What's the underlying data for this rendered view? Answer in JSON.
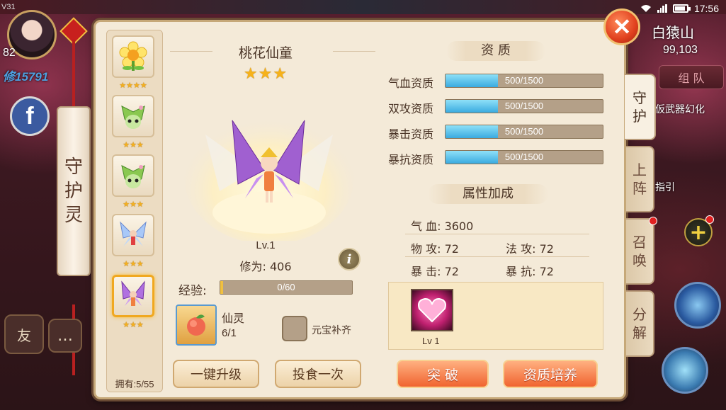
{
  "status_bar": {
    "time": "17:56"
  },
  "hud": {
    "version": "V31",
    "level": "82",
    "power": "修15791",
    "side_scroll_title": [
      "守",
      "护",
      "灵"
    ],
    "friend_label": "友",
    "map_name": "白猿山",
    "map_coord": "99,103",
    "team_label": "组 队",
    "quest_1": "仮武器幻化",
    "quest_2": "指引"
  },
  "pet_list": {
    "pets": [
      {
        "name": "sunflower-pet",
        "stars": "★★★★"
      },
      {
        "name": "leaf-pet-1",
        "stars": "★★★"
      },
      {
        "name": "leaf-pet-2",
        "stars": "★★★"
      },
      {
        "name": "blue-fairy-pet",
        "stars": "★★★"
      },
      {
        "name": "purple-fairy-pet",
        "stars": "★★★"
      }
    ],
    "owned": "拥有:5/55"
  },
  "pet": {
    "name": "桃花仙童",
    "stars": "★★★",
    "level": "Lv.1",
    "cultivation": "修为: 406",
    "exp_label": "经验:",
    "exp_text": "0/60",
    "exp_progress": 0.0,
    "item_name": "仙灵",
    "item_count": "6/1",
    "auto_fill_label": "元宝补齐",
    "upgrade_label": "一键升级",
    "feed_label": "投食一次"
  },
  "aptitude": {
    "title": "资 质",
    "rows": [
      {
        "label": "气血资质",
        "text": "500/1500",
        "progress": 0.333
      },
      {
        "label": "双攻资质",
        "text": "500/1500",
        "progress": 0.333
      },
      {
        "label": "暴击资质",
        "text": "500/1500",
        "progress": 0.333
      },
      {
        "label": "暴抗资质",
        "text": "500/1500",
        "progress": 0.333
      }
    ]
  },
  "attributes": {
    "title": "属性加成",
    "hp": "气 血: 3600",
    "phys_atk": "物 攻: 72",
    "magic_atk": "法 攻: 72",
    "crit": "暴 击: 72",
    "crit_res": "暴 抗: 72"
  },
  "skill": {
    "level": "Lv 1"
  },
  "actions": {
    "breakthrough_label": "突 破",
    "train_label": "资质培养"
  },
  "tabs": [
    {
      "label": [
        "守",
        "护"
      ],
      "active": true
    },
    {
      "label": [
        "上",
        "阵"
      ],
      "active": false
    },
    {
      "label": [
        "召",
        "唤"
      ],
      "active": false
    },
    {
      "label": [
        "分",
        "解"
      ],
      "active": false
    }
  ],
  "colors": {
    "panel_bg": "#f4ead8",
    "accent_orange": "#f06430",
    "aptitude_fill": "#3aaae0",
    "star_gold": "#f6b21a"
  }
}
